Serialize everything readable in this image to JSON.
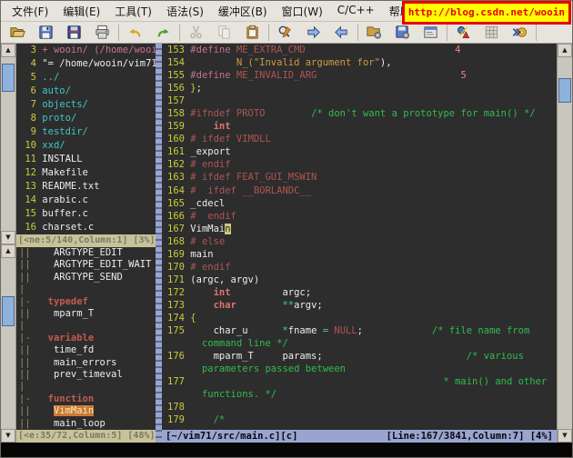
{
  "menubar": {
    "items": [
      "文件(F)",
      "编辑(E)",
      "工具(T)",
      "语法(S)",
      "缓冲区(B)",
      "窗口(W)",
      "C/C++",
      "帮助(H)"
    ],
    "url_annotation": {
      "text": "http://blog.csdn.net/wooin",
      "border_color": "#e80000",
      "background": "#ffff00",
      "text_color": "#e80000"
    }
  },
  "toolbar": {
    "groups": [
      [
        "open",
        "save",
        "save-all",
        "print"
      ],
      [
        "undo",
        "redo"
      ],
      [
        "cut",
        "copy",
        "paste"
      ],
      [
        "find-replace",
        "find-next",
        "find-prev"
      ],
      [
        "load-session",
        "save-session",
        "run-script"
      ],
      [
        "make",
        "build-tags",
        "tag-jump"
      ]
    ]
  },
  "explorer": {
    "lines": [
      {
        "num": "3",
        "cls": "banner",
        "text": "+ wooin/ (/home/wooin"
      },
      {
        "num": "4",
        "cls": "file",
        "text": "\"= /home/wooin/vim71/"
      },
      {
        "num": "5",
        "cls": "dir",
        "text": "../"
      },
      {
        "num": "6",
        "cls": "dir",
        "text": "auto/"
      },
      {
        "num": "7",
        "cls": "dir",
        "text": "objects/"
      },
      {
        "num": "8",
        "cls": "dir",
        "text": "proto/"
      },
      {
        "num": "9",
        "cls": "dir",
        "text": "testdir/"
      },
      {
        "num": "10",
        "cls": "dir",
        "text": "xxd/"
      },
      {
        "num": "11",
        "cls": "file",
        "text": "INSTALL"
      },
      {
        "num": "12",
        "cls": "file",
        "text": "Makefile"
      },
      {
        "num": "13",
        "cls": "file",
        "text": "README.txt"
      },
      {
        "num": "14",
        "cls": "file",
        "text": "arabic.c"
      },
      {
        "num": "15",
        "cls": "file",
        "text": "buffer.c"
      },
      {
        "num": "16",
        "cls": "file",
        "text": "charset.c"
      }
    ],
    "status": "[<ne:5/140,Column:1] [3%]"
  },
  "taglist": {
    "rows": [
      {
        "fold": "||",
        "cls": "tag",
        "indent": 4,
        "text": "ARGTYPE_EDIT"
      },
      {
        "fold": "||",
        "cls": "tag",
        "indent": 4,
        "text": "ARGTYPE_EDIT_WAIT"
      },
      {
        "fold": "||",
        "cls": "tag",
        "indent": 4,
        "text": "ARGTYPE_SEND"
      },
      {
        "fold": "|",
        "cls": "tag",
        "indent": 0,
        "text": ""
      },
      {
        "fold": "|-",
        "cls": "header",
        "indent": 3,
        "text": "typedef"
      },
      {
        "fold": "||",
        "cls": "tag",
        "indent": 4,
        "text": "mparm_T"
      },
      {
        "fold": "|",
        "cls": "tag",
        "indent": 0,
        "text": ""
      },
      {
        "fold": "|-",
        "cls": "header",
        "indent": 3,
        "text": "variable"
      },
      {
        "fold": "||",
        "cls": "tag",
        "indent": 4,
        "text": "time_fd"
      },
      {
        "fold": "||",
        "cls": "tag",
        "indent": 4,
        "text": "main_errors"
      },
      {
        "fold": "||",
        "cls": "tag",
        "indent": 4,
        "text": "prev_timeval"
      },
      {
        "fold": "|",
        "cls": "tag",
        "indent": 0,
        "text": ""
      },
      {
        "fold": "|-",
        "cls": "header",
        "indent": 3,
        "text": "function"
      },
      {
        "fold": "||",
        "cls": "tag",
        "indent": 4,
        "text": "VimMain",
        "hl": true
      },
      {
        "fold": "||",
        "cls": "tag",
        "indent": 4,
        "text": "main_loop"
      }
    ],
    "status": "[<e:35/72,Column:5] [48%]"
  },
  "editor": {
    "lines": [
      {
        "num": "153",
        "segs": [
          [
            "pp",
            "#define "
          ],
          [
            "mac",
            "ME_EXTRA_CMD"
          ],
          [
            "pl",
            "                          "
          ],
          [
            "lit",
            "4"
          ]
        ]
      },
      {
        "num": "154",
        "segs": [
          [
            "pl",
            "        "
          ],
          [
            "str",
            "N_(\"Invalid argument for\""
          ],
          [
            "pl",
            "),"
          ]
        ]
      },
      {
        "num": "155",
        "segs": [
          [
            "pp",
            "#define "
          ],
          [
            "mac",
            "ME_INVALID_ARG"
          ],
          [
            "pl",
            "                         "
          ],
          [
            "lit",
            "5"
          ]
        ]
      },
      {
        "num": "156",
        "segs": [
          [
            "br",
            "}"
          ],
          [
            "pl",
            ";"
          ]
        ]
      },
      {
        "num": "157",
        "segs": []
      },
      {
        "num": "158",
        "segs": [
          [
            "mac",
            "#ifndef PROTO"
          ],
          [
            "pl",
            "        "
          ],
          [
            "cmt",
            "/* don't want a prototype for main() */"
          ]
        ]
      },
      {
        "num": "159",
        "segs": [
          [
            "pl",
            "    "
          ],
          [
            "kw",
            "int"
          ]
        ]
      },
      {
        "num": "160",
        "segs": [
          [
            "mac",
            "# ifdef VIMDLL"
          ]
        ]
      },
      {
        "num": "161",
        "segs": [
          [
            "pl",
            "_export"
          ]
        ]
      },
      {
        "num": "162",
        "segs": [
          [
            "mac",
            "# endif"
          ]
        ]
      },
      {
        "num": "163",
        "segs": [
          [
            "mac",
            "# ifdef FEAT_GUI_MSWIN"
          ]
        ]
      },
      {
        "num": "164",
        "segs": [
          [
            "mac",
            "#  ifdef __BORLANDC__"
          ]
        ]
      },
      {
        "num": "165",
        "segs": [
          [
            "pl",
            "_cdecl"
          ]
        ]
      },
      {
        "num": "166",
        "segs": [
          [
            "mac",
            "#  endif"
          ]
        ]
      },
      {
        "num": "167",
        "segs": [
          [
            "pl",
            "VimMai"
          ],
          [
            "cur",
            "n"
          ]
        ]
      },
      {
        "num": "168",
        "segs": [
          [
            "mac",
            "# else"
          ]
        ]
      },
      {
        "num": "169",
        "segs": [
          [
            "pl",
            "main"
          ]
        ]
      },
      {
        "num": "170",
        "segs": [
          [
            "mac",
            "# endif"
          ]
        ]
      },
      {
        "num": "171",
        "segs": [
          [
            "pl",
            "(argc, argv)"
          ]
        ]
      },
      {
        "num": "172",
        "segs": [
          [
            "pl",
            "    "
          ],
          [
            "kw",
            "int"
          ],
          [
            "pl",
            "         argc;"
          ]
        ]
      },
      {
        "num": "173",
        "segs": [
          [
            "pl",
            "    "
          ],
          [
            "kw",
            "char"
          ],
          [
            "pl",
            "        "
          ],
          [
            "op",
            "**"
          ],
          [
            "pl",
            "argv;"
          ]
        ]
      },
      {
        "num": "174",
        "segs": [
          [
            "br",
            "{"
          ]
        ]
      },
      {
        "num": "175",
        "segs": [
          [
            "pl",
            "    char_u      "
          ],
          [
            "op",
            "*"
          ],
          [
            "pl",
            "fname "
          ],
          [
            "op",
            "="
          ],
          [
            "pl",
            " "
          ],
          [
            "mac",
            "NULL"
          ],
          [
            "pl",
            ";            "
          ],
          [
            "cmt",
            "/* file name from"
          ]
        ]
      },
      {
        "num": "",
        "segs": [
          [
            "cmt",
            "  command line */"
          ]
        ]
      },
      {
        "num": "176",
        "segs": [
          [
            "pl",
            "    mparm_T     params;                         "
          ],
          [
            "cmt",
            "/* various"
          ]
        ]
      },
      {
        "num": "",
        "segs": [
          [
            "cmt",
            "  parameters passed between"
          ]
        ]
      },
      {
        "num": "177",
        "segs": [
          [
            "pl",
            "                                            "
          ],
          [
            "cmt",
            "* main() and other"
          ]
        ]
      },
      {
        "num": "",
        "segs": [
          [
            "cmt",
            "  functions. */"
          ]
        ]
      },
      {
        "num": "178",
        "segs": []
      },
      {
        "num": "179",
        "segs": [
          [
            "pl",
            "    "
          ],
          [
            "cmt",
            "/*"
          ]
        ]
      }
    ],
    "status_left": "[~/vim71/src/main.c][c]",
    "status_right": "[Line:167/3841,Column:7] [4%]"
  },
  "colors": {
    "background": "#2d2d2d",
    "line_number": "#cbcb3a",
    "statusline_active": "#9aa5cf",
    "statusline_inactive": "#c8c29b",
    "selected_tag_bg": "#cc7a33",
    "cursor_bg": "#ccc87e",
    "annotation_border": "#e80000",
    "annotation_bg": "#ffff00"
  }
}
